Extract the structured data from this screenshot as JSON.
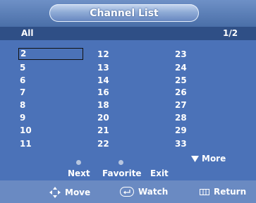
{
  "title": "Channel List",
  "subheader": {
    "filter": "All",
    "page": "1/2"
  },
  "channels": [
    [
      "2",
      "5",
      "6",
      "7",
      "8",
      "9",
      "10",
      "11"
    ],
    [
      "12",
      "13",
      "14",
      "16",
      "18",
      "20",
      "21",
      "22"
    ],
    [
      "23",
      "24",
      "25",
      "26",
      "27",
      "28",
      "29",
      "33"
    ]
  ],
  "more_label": "More",
  "actions": {
    "next": "Next",
    "favorite": "Favorite",
    "exit": "Exit"
  },
  "footer": {
    "move": "Move",
    "watch": "Watch",
    "return": "Return"
  },
  "colors": {
    "background": "#8fb0de",
    "panel": "#4b72b8",
    "subbar": "#2f4f86",
    "text": "#ffffff"
  },
  "icons": {
    "move": "four-way-arrows-icon",
    "watch": "enter-key-icon",
    "return": "return-grid-icon",
    "more": "triangle-down-icon"
  }
}
